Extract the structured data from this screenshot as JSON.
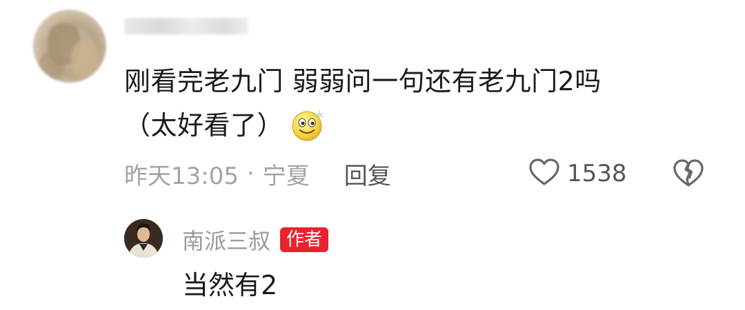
{
  "comment": {
    "text_line1": "刚看完老九门 弱弱问一句还有老九门2吗",
    "text_line2": "（太好看了）",
    "emoji": "smile-emoji",
    "time": "昨天13:05",
    "separator": "·",
    "location": "宁夏",
    "reply_label": "回复",
    "like_count": "1538"
  },
  "reply": {
    "username": "南派三叔",
    "badge": "作者",
    "text": "当然有2"
  },
  "colors": {
    "text_primary": "#1a1a1a",
    "text_meta": "#a3a3a3",
    "badge_red": "#e8232f"
  }
}
